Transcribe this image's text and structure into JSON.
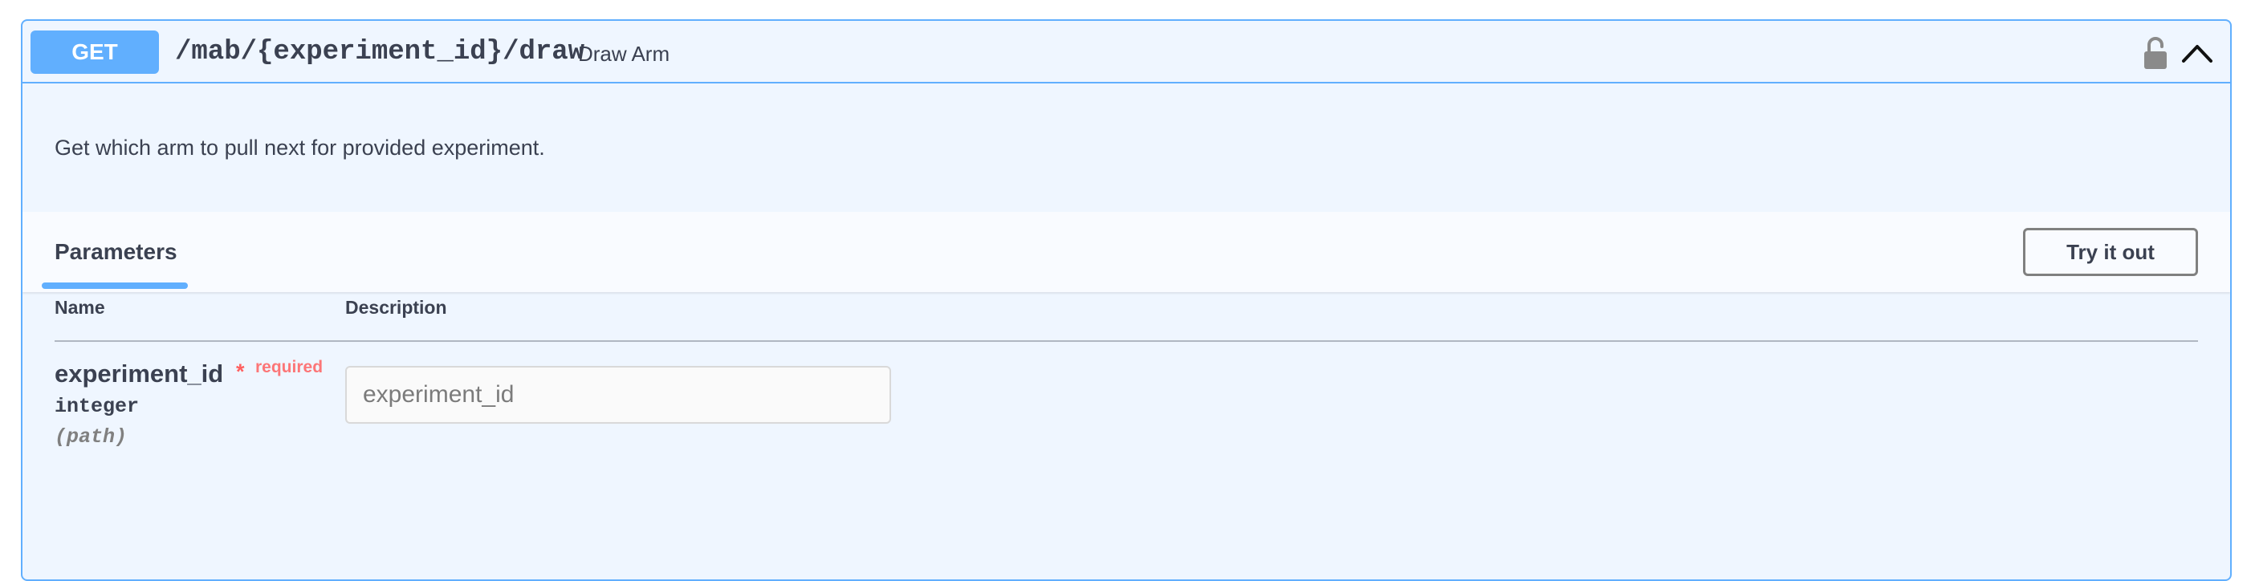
{
  "operation": {
    "method": "GET",
    "path": "/mab/{experiment_id}/draw",
    "summary": "Draw Arm",
    "description": "Get which arm to pull next for provided experiment.",
    "colors": {
      "accent": "#61affe",
      "background": "#eff6ff",
      "required": "#ff6060"
    },
    "icons": {
      "lock": "unlocked-padlock-icon",
      "collapse": "chevron-up-icon"
    }
  },
  "parameters_section": {
    "tab_label": "Parameters",
    "try_button_label": "Try it out",
    "columns": {
      "name": "Name",
      "description": "Description"
    },
    "params": [
      {
        "name": "experiment_id",
        "asterisk": "*",
        "required_label": "required",
        "type": "integer",
        "in": "(path)",
        "value": "",
        "placeholder": "experiment_id"
      }
    ]
  }
}
